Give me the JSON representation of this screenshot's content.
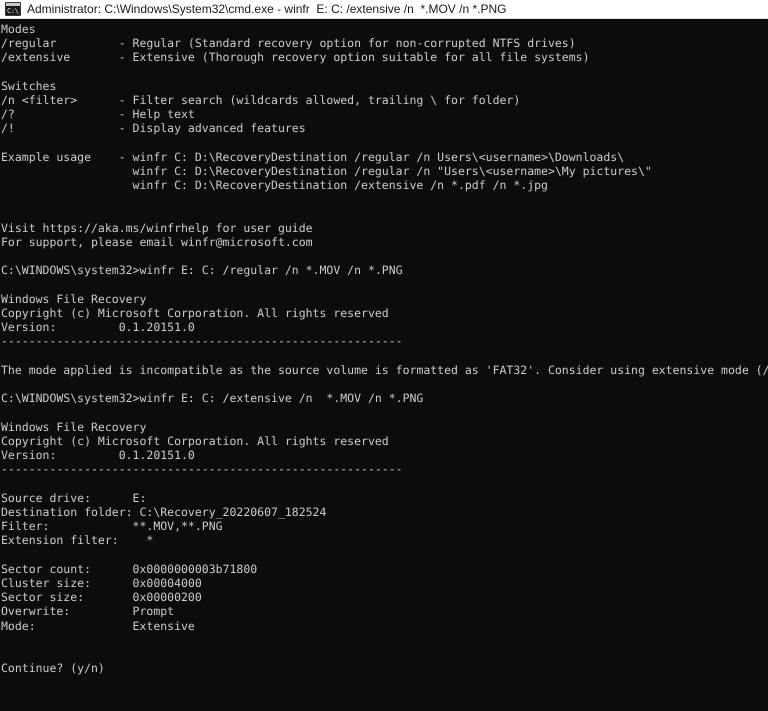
{
  "window": {
    "title": "Administrator: C:\\Windows\\System32\\cmd.exe - winfr  E: C: /extensive /n  *.MOV /n *.PNG",
    "icon": "cmd-console-icon",
    "icon_glyph": "C:\\",
    "background_color": "#0c0c0c",
    "foreground_color": "#cccccc",
    "titlebar_background": "#ffffff",
    "titlebar_foreground": "#1a1a1a"
  },
  "console": {
    "lines": [
      "Modes",
      "/regular         - Regular (Standard recovery option for non-corrupted NTFS drives)",
      "/extensive       - Extensive (Thorough recovery option suitable for all file systems)",
      "",
      "Switches",
      "/n <filter>      - Filter search (wildcards allowed, trailing \\ for folder)",
      "/?               - Help text",
      "/!               - Display advanced features",
      "",
      "Example usage    - winfr C: D:\\RecoveryDestination /regular /n Users\\<username>\\Downloads\\",
      "                   winfr C: D:\\RecoveryDestination /regular /n \"Users\\<username>\\My pictures\\\"",
      "                   winfr C: D:\\RecoveryDestination /extensive /n *.pdf /n *.jpg",
      "",
      "",
      "Visit https://aka.ms/winfrhelp for user guide",
      "For support, please email winfr@microsoft.com",
      "",
      "C:\\WINDOWS\\system32>winfr E: C: /regular /n *.MOV /n *.PNG",
      "",
      "Windows File Recovery",
      "Copyright (c) Microsoft Corporation. All rights reserved",
      "Version:         0.1.20151.0",
      "----------------------------------------------------------",
      "",
      "The mode applied is incompatible as the source volume is formatted as 'FAT32'. Consider using extensive mode (/extensive).",
      "",
      "C:\\WINDOWS\\system32>winfr E: C: /extensive /n  *.MOV /n *.PNG",
      "",
      "Windows File Recovery",
      "Copyright (c) Microsoft Corporation. All rights reserved",
      "Version:         0.1.20151.0",
      "----------------------------------------------------------",
      "",
      "Source drive:      E:",
      "Destination folder: C:\\Recovery_20220607_182524",
      "Filter:            **.MOV,**.PNG",
      "Extension filter:    *",
      "",
      "Sector count:      0x0000000003b71800",
      "Cluster size:      0x00004000",
      "Sector size:       0x00000200",
      "Overwrite:         Prompt",
      "Mode:              Extensive",
      "",
      "",
      "Continue? (y/n)"
    ]
  }
}
